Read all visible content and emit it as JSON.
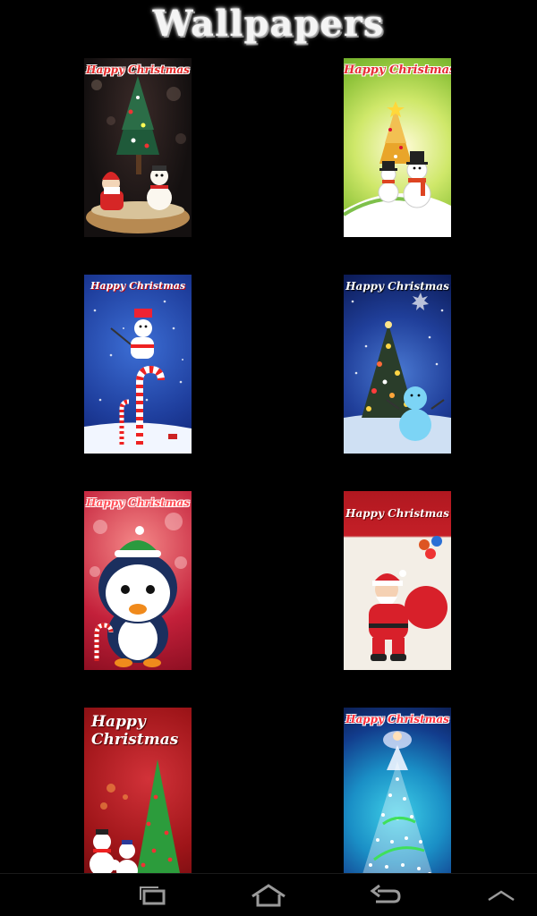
{
  "header": {
    "title": "Wallpapers"
  },
  "wallpapers": [
    {
      "greeting": "Happy Christmas",
      "icon": "christmas-tree-santa-snowman"
    },
    {
      "greeting": "Happy Christmas",
      "icon": "snowmen-golden-tree"
    },
    {
      "greeting": "Happy Christmas",
      "icon": "snowman-candy-cane"
    },
    {
      "greeting": "Happy Christmas",
      "icon": "lit-tree-snowman"
    },
    {
      "greeting": "Happy Christmas",
      "icon": "penguin"
    },
    {
      "greeting": "Happy Christmas",
      "icon": "santa-with-sack"
    },
    {
      "greeting": "Happy\nChristmas",
      "icon": "snowmen-green-tree"
    },
    {
      "greeting": "Happy Christmas",
      "icon": "angel-star-tree"
    }
  ],
  "navbar": {
    "icons": [
      "recents-icon",
      "home-icon",
      "back-icon",
      "menu-up-icon"
    ]
  },
  "colors": {
    "background": "#000000",
    "title": "#f4f4f4",
    "navIcon": "#9a9a9a"
  }
}
